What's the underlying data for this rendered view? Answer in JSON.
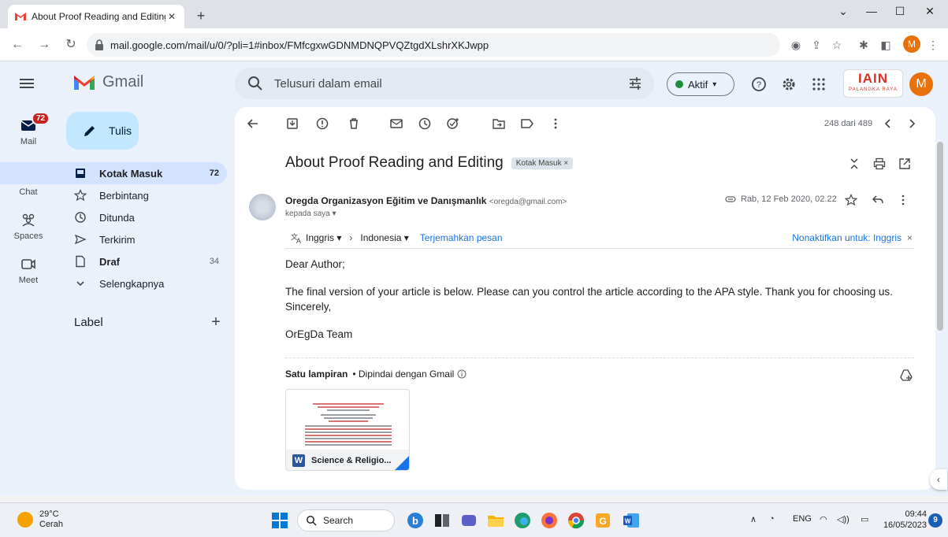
{
  "browser": {
    "tab_title": "About Proof Reading and Editing",
    "url": "mail.google.com/mail/u/0/?pli=1#inbox/FMfcgxwGDNMDNQPVQZtgdXLshrXKJwpp",
    "profile_initial": "M"
  },
  "header": {
    "app_name": "Gmail",
    "search_placeholder": "Telusuri dalam email",
    "status": "Aktif",
    "brand_logo": "IAIN",
    "brand_sub": "PALANGKA RAYA",
    "avatar_initial": "M"
  },
  "rail": {
    "mail_label": "Mail",
    "mail_badge": "72",
    "chat_label": "Chat",
    "spaces_label": "Spaces",
    "meet_label": "Meet"
  },
  "sidebar": {
    "compose": "Tulis",
    "items": [
      {
        "label": "Kotak Masuk",
        "count": "72",
        "icon": "inbox-icon"
      },
      {
        "label": "Berbintang",
        "count": "",
        "icon": "star-icon"
      },
      {
        "label": "Ditunda",
        "count": "",
        "icon": "clock-icon"
      },
      {
        "label": "Terkirim",
        "count": "",
        "icon": "send-icon"
      },
      {
        "label": "Draf",
        "count": "34",
        "icon": "draft-icon"
      },
      {
        "label": "Selengkapnya",
        "count": "",
        "icon": "chevron-down-icon"
      }
    ],
    "labels_header": "Label"
  },
  "toolbar": {
    "pager": "248 dari 489"
  },
  "email": {
    "subject": "About Proof Reading and Editing",
    "tag": "Kotak Masuk ×",
    "sender_name": "Oregda Organizasyon Eğitim ve Danışmanlık",
    "sender_email": "<oregda@gmail.com>",
    "to": "kepada saya ▾",
    "date": "Rab, 12 Feb 2020, 02.22",
    "translate": {
      "from": "Inggris ▾",
      "to": "Indonesia ▾",
      "action": "Terjemahkan pesan",
      "disable": "Nonaktifkan untuk: Inggris",
      "close": "×"
    },
    "body": {
      "greeting": "Dear Author;",
      "para1": "The final version of your article is below. Please can you control the article according to the APA style. Thank you for choosing us.",
      "closing": "Sincerely,",
      "signature": "OrEgDa Team"
    },
    "attachments": {
      "header_bold": "Satu lampiran",
      "header_rest": "• Dipindai dengan Gmail",
      "file_name": "Science & Religio..."
    }
  },
  "taskbar": {
    "weather_temp": "29°C",
    "weather_desc": "Cerah",
    "search": "Search",
    "lang": "ENG",
    "time": "09:44",
    "date": "16/05/2023",
    "notif_count": "9"
  }
}
